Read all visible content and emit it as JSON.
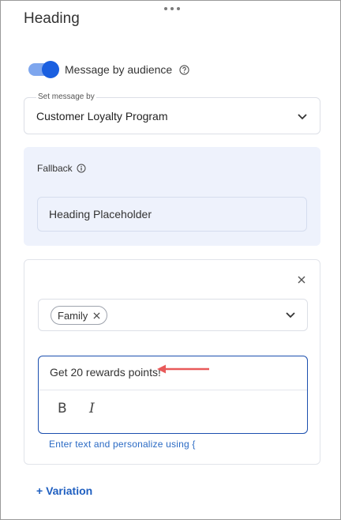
{
  "panel": {
    "title": "Heading"
  },
  "audience_toggle": {
    "label": "Message by audience",
    "enabled": true,
    "help_icon": "question-circle-icon"
  },
  "set_message": {
    "legend": "Set message by",
    "value": "Customer Loyalty Program"
  },
  "fallback": {
    "label": "Fallback",
    "info_icon": "info-circle-icon",
    "value": "Heading Placeholder"
  },
  "variation": {
    "close_icon": "close-icon",
    "audience_chip": "Family",
    "editor_text": "Get 20 rewards points!",
    "bold_label": "B",
    "italic_label": "I",
    "hint": "Enter text and personalize using {"
  },
  "add_variation_label": "+ Variation",
  "colors": {
    "accent": "#1a5fe0",
    "toggle_track": "#7ea6ee",
    "fallback_bg": "#eef2fc",
    "editor_border": "#1b4fae",
    "arrow": "#e85a5a",
    "link": "#1f5fc0"
  }
}
